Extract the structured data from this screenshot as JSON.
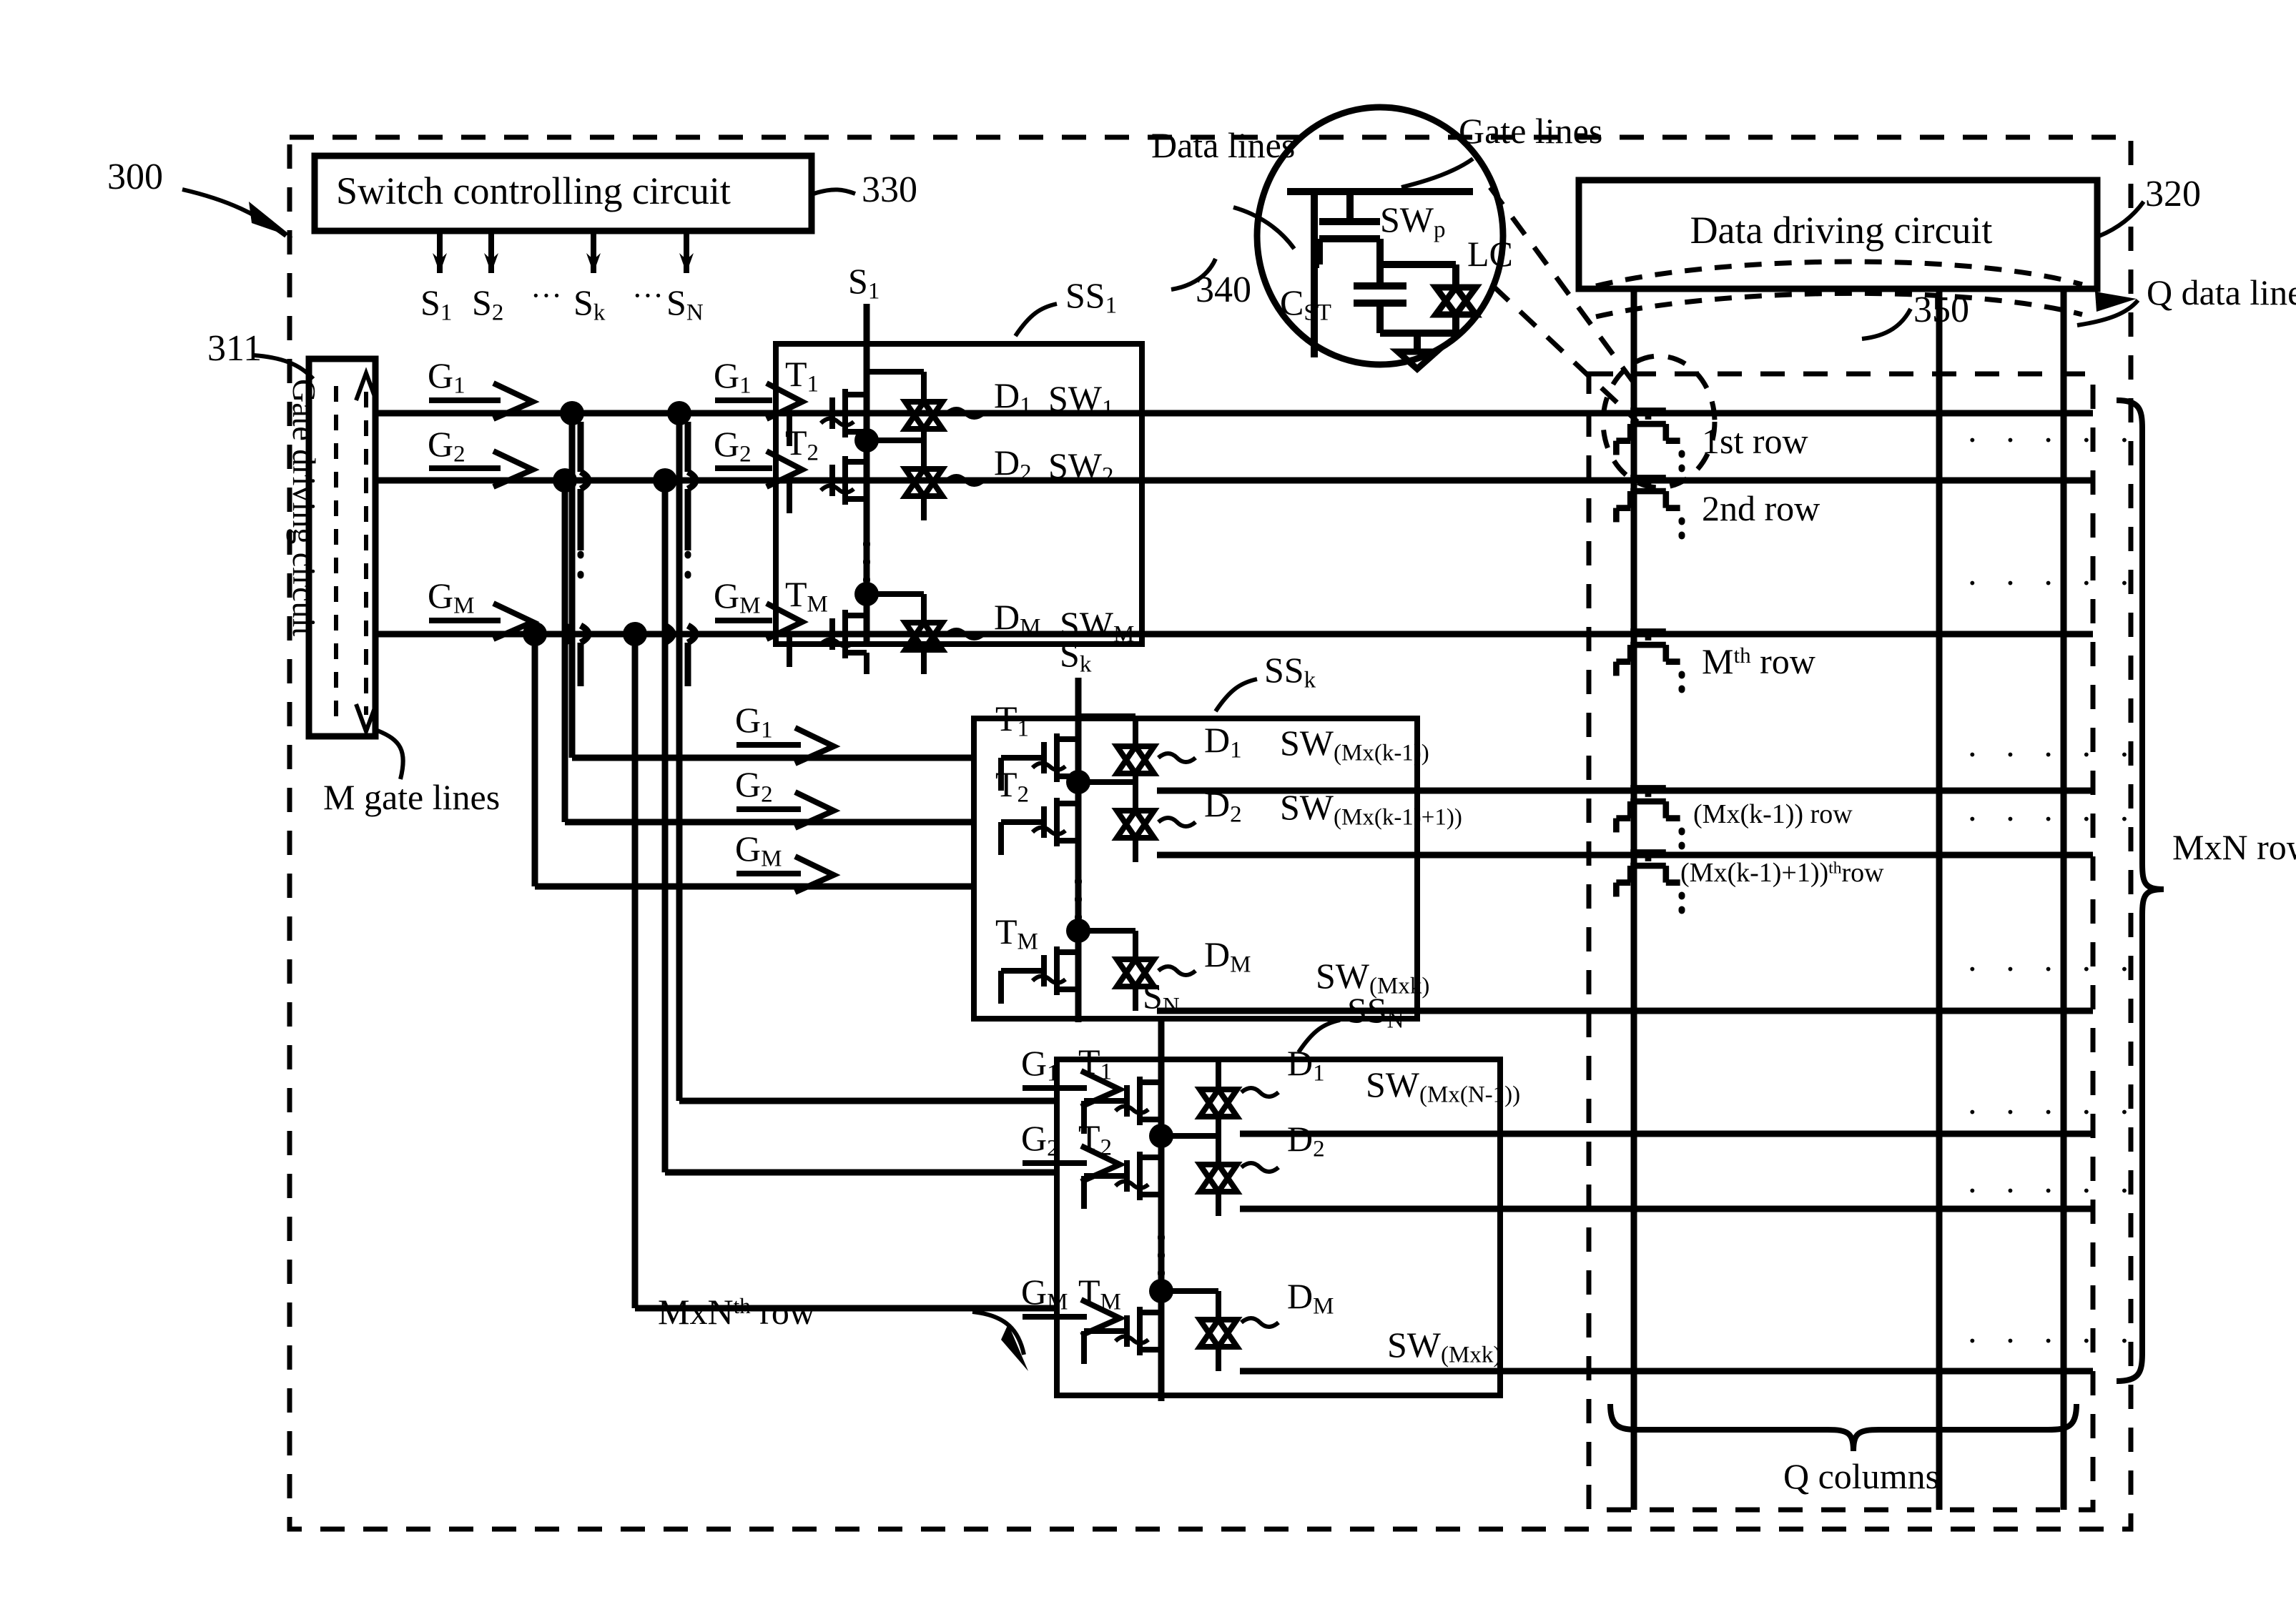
{
  "figure": {
    "ref_main": "300",
    "ref_gate_driver": "311",
    "ref_switch_ctrl": "330",
    "ref_data_driver": "320",
    "ref_data_lines": "340",
    "ref_panel": "350"
  },
  "blocks": {
    "switch_controlling_circuit": "Switch controlling circuit",
    "gate_driving_circuit": "Gate driving circuit",
    "data_driving_circuit": "Data driving circuit"
  },
  "callouts": {
    "data_lines": "Data lines",
    "gate_lines": "Gate lines",
    "q_data_lines": "Q data lines",
    "m_gate_lines": "M gate lines",
    "mxn_rows": "MxN rows",
    "q_columns": "Q columns",
    "mxn_th_row": "MxN",
    "mxn_th_row_sup": "th",
    "mxn_th_row_tail": "row"
  },
  "switch_signals": [
    {
      "base": "S",
      "sub": "1"
    },
    {
      "base": "S",
      "sub": "2"
    },
    {
      "ellipsis": "···"
    },
    {
      "base": "S",
      "sub": "k"
    },
    {
      "ellipsis": "···"
    },
    {
      "base": "S",
      "sub": "N"
    }
  ],
  "gate_signals": [
    {
      "base": "G",
      "sub": "1"
    },
    {
      "base": "G",
      "sub": "2"
    },
    {
      "base": "G",
      "sub": "M"
    }
  ],
  "pixel_detail": {
    "transistor": "SW",
    "transistor_sub": "p",
    "capacitor": "C",
    "capacitor_sub": "ST",
    "liquid_crystal": "LC"
  },
  "switch_sets": [
    {
      "name": "SS",
      "name_sub": "1",
      "source": {
        "base": "S",
        "sub": "1"
      },
      "rows": [
        {
          "t": "T",
          "t_sub": "1",
          "d": "D",
          "d_sub": "1",
          "sw": "SW",
          "sw_sub": "1",
          "gate": {
            "base": "G",
            "sub": "1"
          }
        },
        {
          "t": "T",
          "t_sub": "2",
          "d": "D",
          "d_sub": "2",
          "sw": "SW",
          "sw_sub": "2",
          "gate": {
            "base": "G",
            "sub": "2"
          }
        },
        {
          "t": "T",
          "t_sub": "M",
          "d": "D",
          "d_sub": "M",
          "sw": "SW",
          "sw_sub": "M",
          "gate": {
            "base": "G",
            "sub": "M"
          }
        }
      ]
    },
    {
      "name": "SS",
      "name_sub": "k",
      "source": {
        "base": "S",
        "sub": "k"
      },
      "rows": [
        {
          "t": "T",
          "t_sub": "1",
          "d": "D",
          "d_sub": "1",
          "sw": "SW",
          "sw_sub": "(Mx(k-1))",
          "gate": {
            "base": "G",
            "sub": "1"
          }
        },
        {
          "t": "T",
          "t_sub": "2",
          "d": "D",
          "d_sub": "2",
          "sw": "SW",
          "sw_sub": "(Mx(k-1)+1))",
          "gate": {
            "base": "G",
            "sub": "2"
          }
        },
        {
          "t": "T",
          "t_sub": "M",
          "d": "D",
          "d_sub": "M",
          "sw": "SW",
          "sw_sub": "(Mxk)",
          "gate": {
            "base": "G",
            "sub": "M"
          }
        }
      ]
    },
    {
      "name": "SS",
      "name_sub": "N",
      "source": {
        "base": "S",
        "sub": "N"
      },
      "rows": [
        {
          "t": "T",
          "t_sub": "1",
          "d": "D",
          "d_sub": "1",
          "sw": "SW",
          "sw_sub": "(Mx(N-1))",
          "gate": {
            "base": "G",
            "sub": "1"
          }
        },
        {
          "t": "T",
          "t_sub": "2",
          "d": "D",
          "d_sub": "2",
          "sw": "",
          "sw_sub": "",
          "gate": {
            "base": "G",
            "sub": "2"
          }
        },
        {
          "t": "T",
          "t_sub": "M",
          "d": "D",
          "d_sub": "M",
          "sw": "SW",
          "sw_sub": "(Mxk)",
          "gate": {
            "base": "G",
            "sub": "M"
          }
        }
      ]
    }
  ],
  "panel_rows": [
    {
      "label": "1st  row",
      "sup": "",
      "dots": "· · · · ·"
    },
    {
      "label": "2nd  row",
      "sup": "",
      "dots": "· · · · ·"
    },
    {
      "label_pre": "M",
      "sup": "th",
      "label_post": " row",
      "dots": "· · · · ·"
    },
    {
      "label": "(Mx(k-1))  row",
      "sup": "",
      "dots": "· · · · ·"
    },
    {
      "label_pre": "(Mx(k-1)+1))",
      "sup": "th",
      "label_post": "row",
      "dots": ""
    },
    {
      "label": "",
      "sup": "",
      "dots": "· · · · ·"
    },
    {
      "label": "",
      "sup": "",
      "dots": "· · · · ·"
    },
    {
      "label": "",
      "sup": "",
      "dots": "· · · · ·"
    },
    {
      "label": "",
      "sup": "",
      "dots": "· · · · ·"
    }
  ],
  "colors": {
    "ink": "#000000",
    "paper": "#ffffff"
  }
}
